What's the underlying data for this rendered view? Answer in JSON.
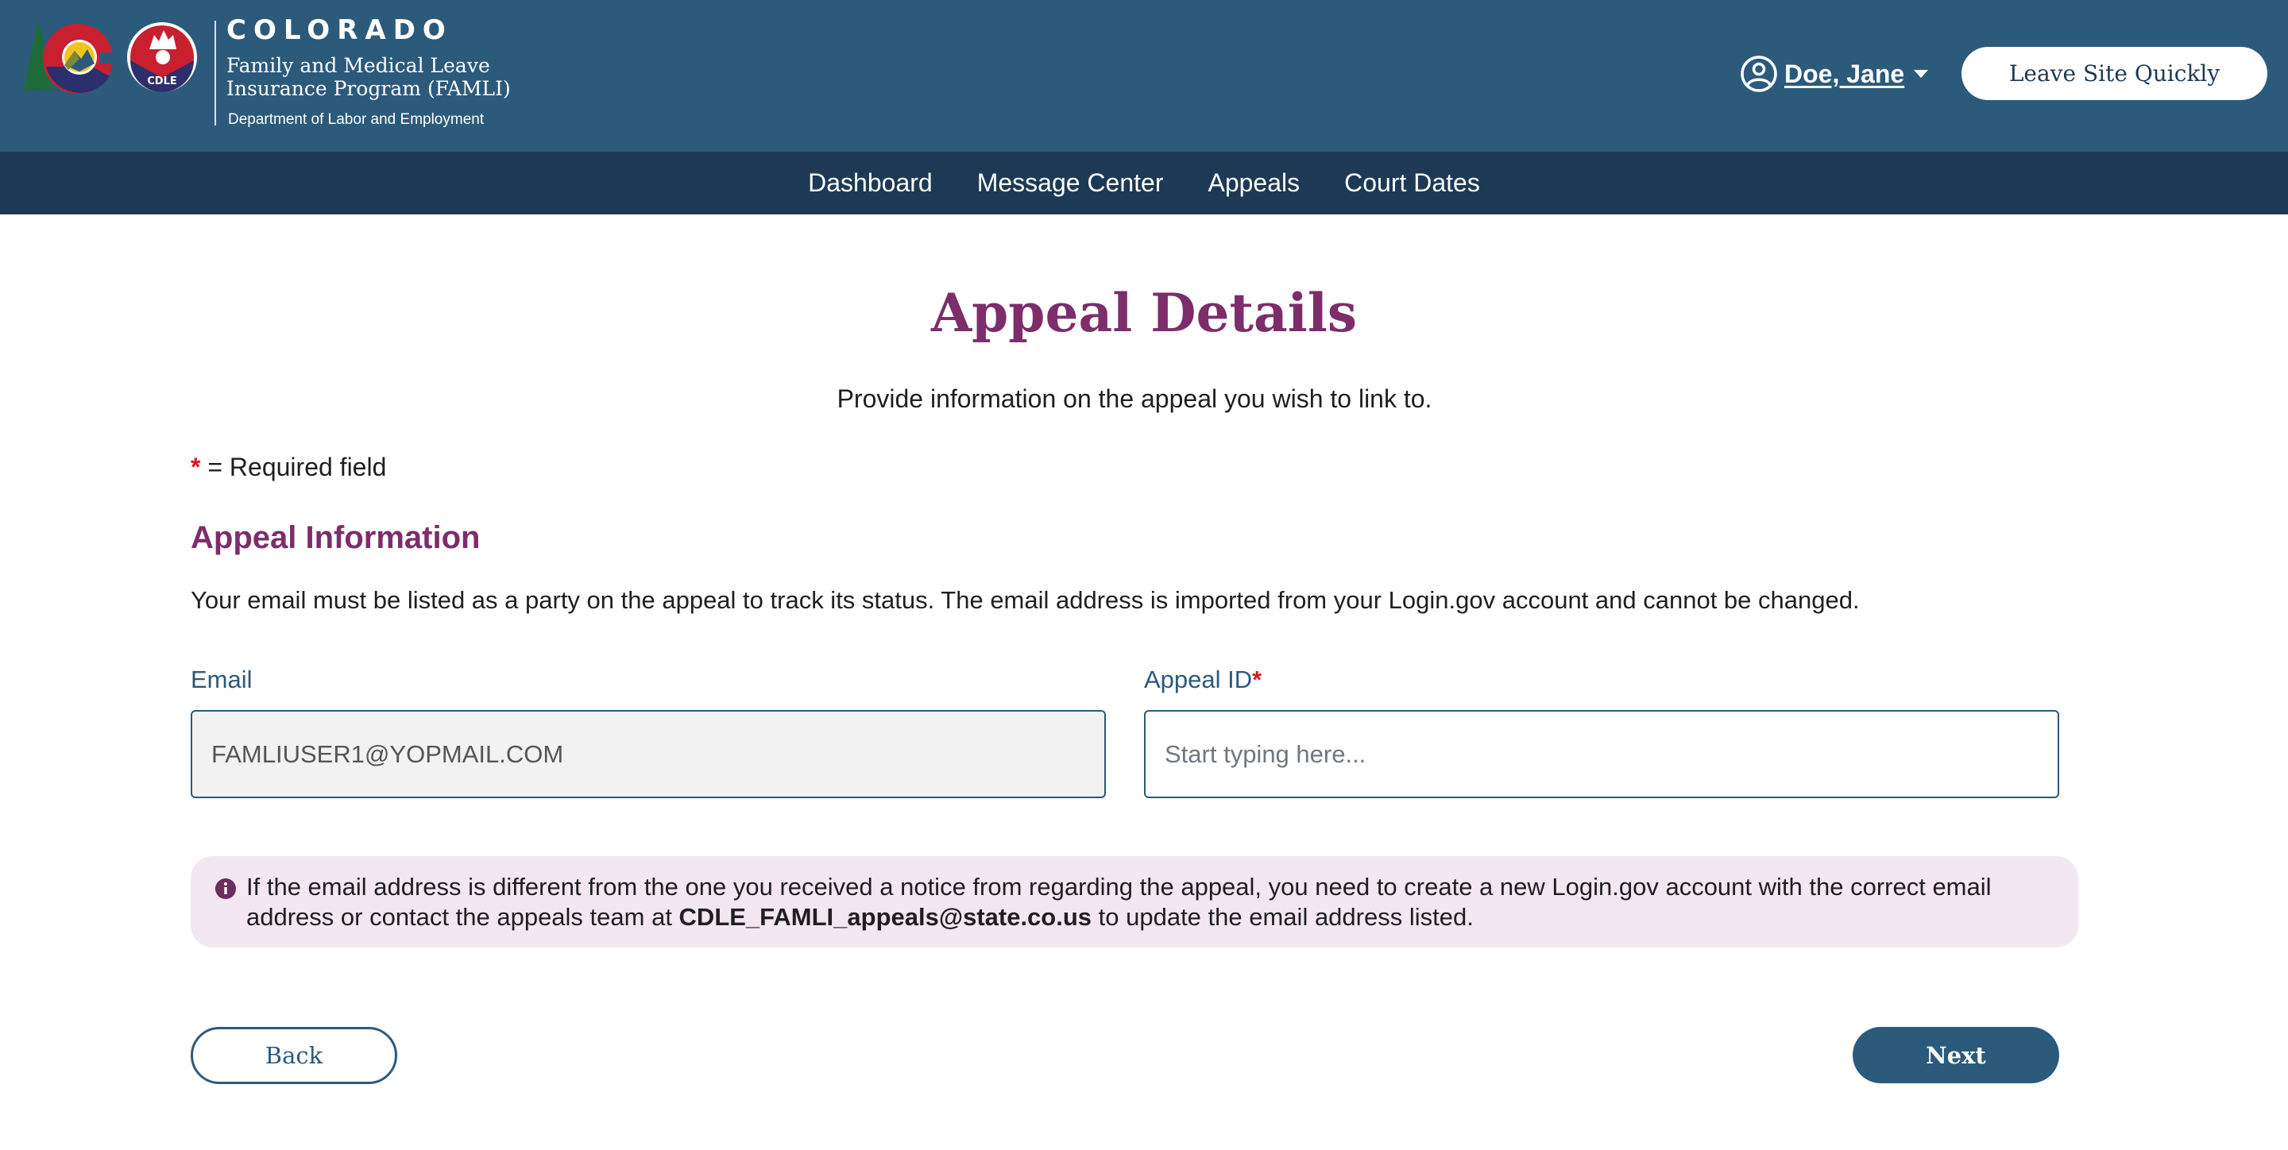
{
  "header": {
    "brand_state": "COLORADO",
    "program_name_line1": "Family and Medical Leave",
    "program_name_line2": "Insurance Program (FAMLI)",
    "department": "Department of Labor and Employment",
    "seal_text": "CDLE",
    "user_name": "Doe, Jane",
    "leave_site_label": "Leave Site Quickly",
    "colors": {
      "header_bg": "#2c5a7b",
      "nav_bg": "#1d3955"
    }
  },
  "nav": {
    "items": [
      {
        "label": "Dashboard"
      },
      {
        "label": "Message Center"
      },
      {
        "label": "Appeals"
      },
      {
        "label": "Court Dates"
      }
    ]
  },
  "main": {
    "title": "Appeal Details",
    "subtitle": "Provide information on the appeal you wish to link to.",
    "required_star": "*",
    "required_note": " = Required field",
    "section_title": "Appeal Information",
    "section_desc": "Your email must be listed as a party on the appeal to track its status. The email address is imported from your Login.gov account and cannot be changed.",
    "fields": {
      "email": {
        "label": "Email",
        "value": "FAMLIUSER1@YOPMAIL.COM",
        "readonly": true
      },
      "appeal_id": {
        "label": "Appeal ID",
        "required_star": "*",
        "value": "",
        "placeholder": "Start typing here..."
      }
    },
    "info": {
      "text_before": "If the email address is different from the one you received a notice from regarding the appeal, you need to create a new Login.gov account with the correct email address or contact the appeals team at ",
      "email_bold": "CDLE_FAMLI_appeals@state.co.us",
      "text_after": " to update the email address listed."
    },
    "buttons": {
      "back": "Back",
      "next": "Next"
    },
    "colors": {
      "accent_purple": "#7c2d6a",
      "primary_blue": "#2c5a7b",
      "required_red": "#e0141c",
      "info_bg": "#f3e7f1"
    }
  }
}
